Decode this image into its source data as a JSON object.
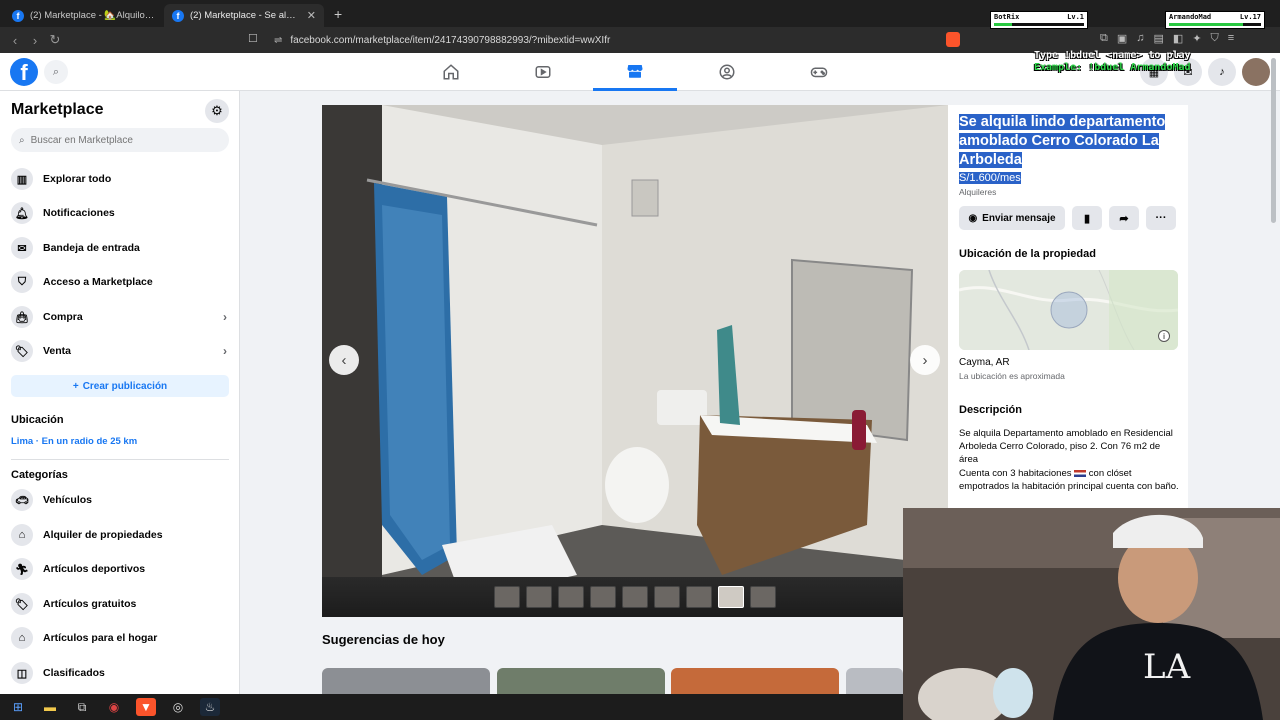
{
  "browser": {
    "tabs": [
      {
        "title": "(2) Marketplace - 🏡Alquilo departam"
      },
      {
        "title": "(2) Marketplace - Se alquila lindo"
      }
    ],
    "url": "facebook.com/marketplace/item/24174390798882993/?mibextid=wwXIfr"
  },
  "sidebar": {
    "title": "Marketplace",
    "search_placeholder": "Buscar en Marketplace",
    "items": [
      {
        "label": "Explorar todo"
      },
      {
        "label": "Notificaciones"
      },
      {
        "label": "Bandeja de entrada"
      },
      {
        "label": "Acceso a Marketplace"
      },
      {
        "label": "Compra"
      },
      {
        "label": "Venta"
      }
    ],
    "create_label": "Crear publicación",
    "location_heading": "Ubicación",
    "location_value": "Lima · En un radio de 25 km",
    "categories_heading": "Categorías",
    "categories": [
      {
        "label": "Vehículos"
      },
      {
        "label": "Alquiler de propiedades"
      },
      {
        "label": "Artículos deportivos"
      },
      {
        "label": "Artículos gratuitos"
      },
      {
        "label": "Artículos para el hogar"
      },
      {
        "label": "Clasificados"
      }
    ]
  },
  "main": {
    "suggestions_title": "Sugerencias de hoy"
  },
  "listing": {
    "title": "Se alquila lindo departamento amoblado Cerro Colorado La Arboleda",
    "price": "S/1.600/mes",
    "category": "Alquileres",
    "send_message_label": "Enviar mensaje",
    "more_label": "···",
    "location_heading": "Ubicación de la propiedad",
    "city": "Cayma, AR",
    "approx_note": "La ubicación es aproximada",
    "description_heading": "Descripción",
    "description_1": "Se alquila Departamento amoblado  en Residencial Arboleda Cerro Colorado, piso 2. Con 76 m2 de área",
    "description_2a": "Cuenta con 3 habitaciones ",
    "description_2b": " con clóset empotrados la habitación principal cuenta con baño."
  },
  "stream_overlay": {
    "line1": "Type !bduel <name> to play",
    "line2": "Example: !bduel ArmandoMad",
    "hud_left_name": "BotRix",
    "hud_left_level": "Lv.1",
    "hud_right_name": "ArmandoMad",
    "hud_right_level": "Lv.17"
  },
  "colors": {
    "fb_blue": "#1877f2",
    "selection": "#2a62c8",
    "overlay_green": "#30d94b"
  }
}
